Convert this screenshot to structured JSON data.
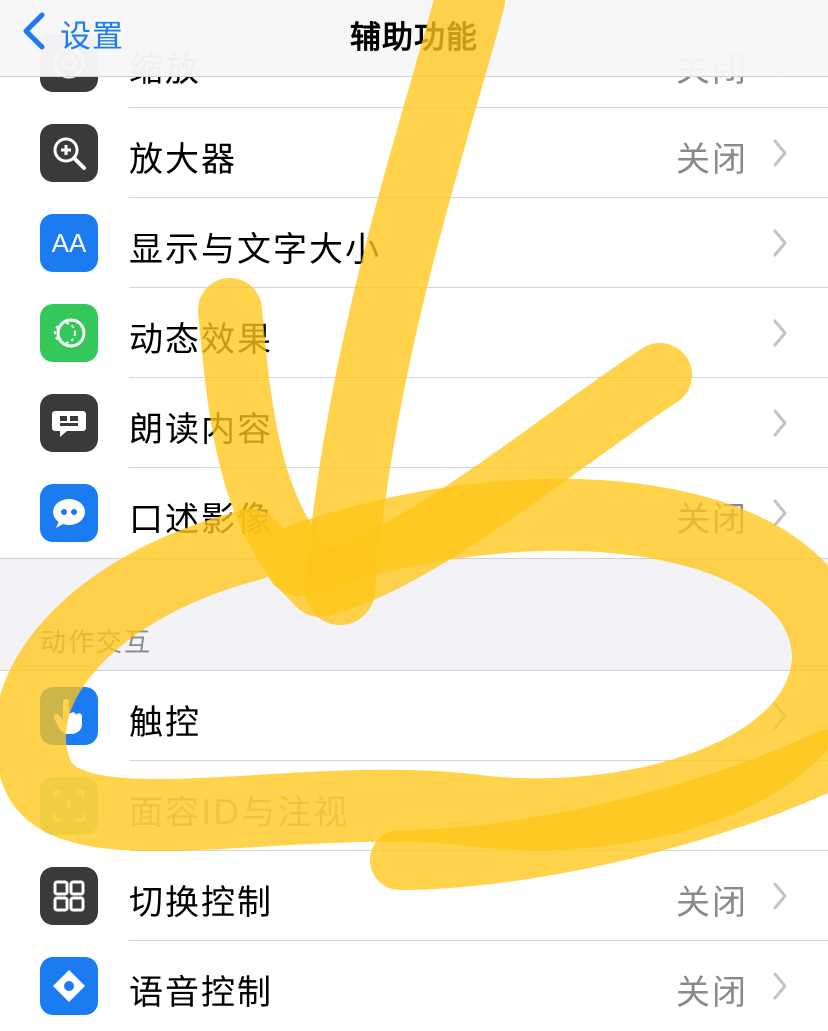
{
  "navbar": {
    "back_label": "设置",
    "title": "辅助功能"
  },
  "group1": {
    "rows": [
      {
        "label": "缩放",
        "value": "关闭",
        "icon": "zoom-icon",
        "color": "#3a3a3c"
      },
      {
        "label": "放大器",
        "value": "关闭",
        "icon": "magnifier-icon",
        "color": "#3a3a3c"
      },
      {
        "label": "显示与文字大小",
        "value": "",
        "icon": "text-size-icon",
        "color": "#1a7cf0",
        "glyph": "AA"
      },
      {
        "label": "动态效果",
        "value": "",
        "icon": "motion-icon",
        "color": "#34c759"
      },
      {
        "label": "朗读内容",
        "value": "",
        "icon": "speech-bubble-icon",
        "color": "#3a3a3c"
      },
      {
        "label": "口述影像",
        "value": "关闭",
        "icon": "quote-bubble-icon",
        "color": "#1a7cf0"
      }
    ]
  },
  "section2": {
    "header": "动作交互",
    "rows": [
      {
        "label": "触控",
        "value": "",
        "icon": "hand-pointer-icon",
        "color": "#1a7cf0"
      },
      {
        "label": "面容ID与注视",
        "value": "",
        "icon": "face-id-icon",
        "color": "#34c759"
      },
      {
        "label": "切换控制",
        "value": "关闭",
        "icon": "grid-icon",
        "color": "#3a3a3c"
      },
      {
        "label": "语音控制",
        "value": "关闭",
        "icon": "voice-control-icon",
        "color": "#1a7cf0"
      }
    ]
  },
  "annotation": {
    "stroke_color": "#ffc61a"
  }
}
